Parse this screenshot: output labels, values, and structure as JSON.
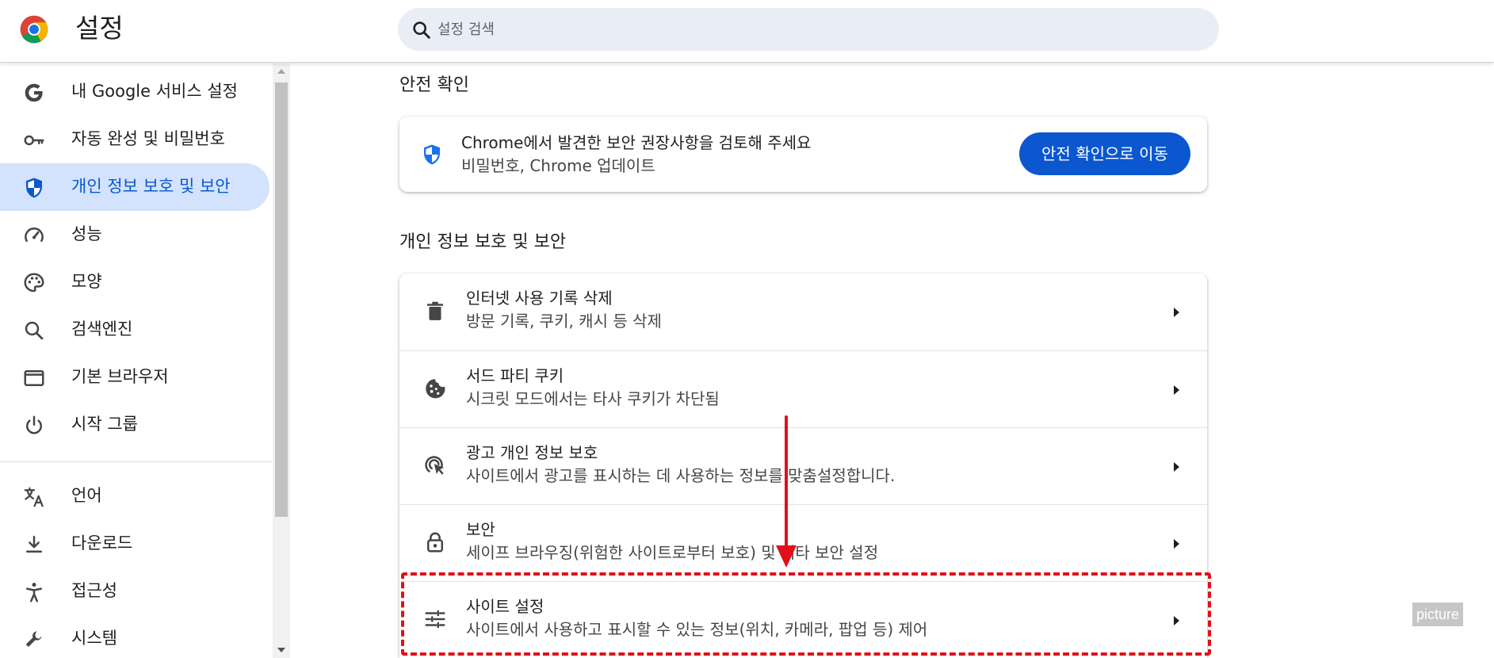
{
  "header": {
    "title": "설정",
    "search_placeholder": "설정 검색",
    "search_value": ""
  },
  "sidebar": {
    "items": [
      {
        "label": "내 Google 서비스 설정",
        "icon": "google-g-icon"
      },
      {
        "label": "자동 완성 및 비밀번호",
        "icon": "key-icon"
      },
      {
        "label": "개인 정보 보호 및 보안",
        "icon": "shield-icon",
        "active": true
      },
      {
        "label": "성능",
        "icon": "speedometer-icon"
      },
      {
        "label": "모양",
        "icon": "palette-icon"
      },
      {
        "label": "검색엔진",
        "icon": "search-icon"
      },
      {
        "label": "기본 브라우저",
        "icon": "browser-window-icon"
      },
      {
        "label": "시작 그룹",
        "icon": "power-icon"
      },
      {
        "label": "언어",
        "icon": "translate-icon"
      },
      {
        "label": "다운로드",
        "icon": "download-icon"
      },
      {
        "label": "접근성",
        "icon": "accessibility-icon"
      },
      {
        "label": "시스템",
        "icon": "wrench-icon"
      }
    ]
  },
  "safety_check": {
    "section_title": "안전 확인",
    "title": "Chrome에서 발견한 보안 권장사항을 검토해 주세요",
    "subtitle": "비밀번호, Chrome 업데이트",
    "button_label": "안전 확인으로 이동"
  },
  "privacy": {
    "section_title": "개인 정보 보호 및 보안",
    "rows": [
      {
        "title": "인터넷 사용 기록 삭제",
        "subtitle": "방문 기록, 쿠키, 캐시 등 삭제",
        "icon": "trash-icon"
      },
      {
        "title": "서드 파티 쿠키",
        "subtitle": "시크릿 모드에서는 타사 쿠키가 차단됨",
        "icon": "cookie-icon"
      },
      {
        "title": "광고 개인 정보 보호",
        "subtitle": "사이트에서 광고를 표시하는 데 사용하는 정보를 맞춤설정합니다.",
        "icon": "ad-privacy-icon"
      },
      {
        "title": "보안",
        "subtitle": "세이프 브라우징(위험한 사이트로부터 보호) 및 기타 보안 설정",
        "icon": "lock-icon"
      },
      {
        "title": "사이트 설정",
        "subtitle": "사이트에서 사용하고 표시할 수 있는 정보(위치, 카메라, 팝업 등) 제어",
        "icon": "tune-icon",
        "highlighted": true
      }
    ]
  },
  "colors": {
    "accent": "#0b57d0",
    "active_nav_bg": "#d3e3fd",
    "search_bg": "#e9eef6",
    "annotation": "#e0101a"
  },
  "watermark": {
    "text": "picture"
  }
}
